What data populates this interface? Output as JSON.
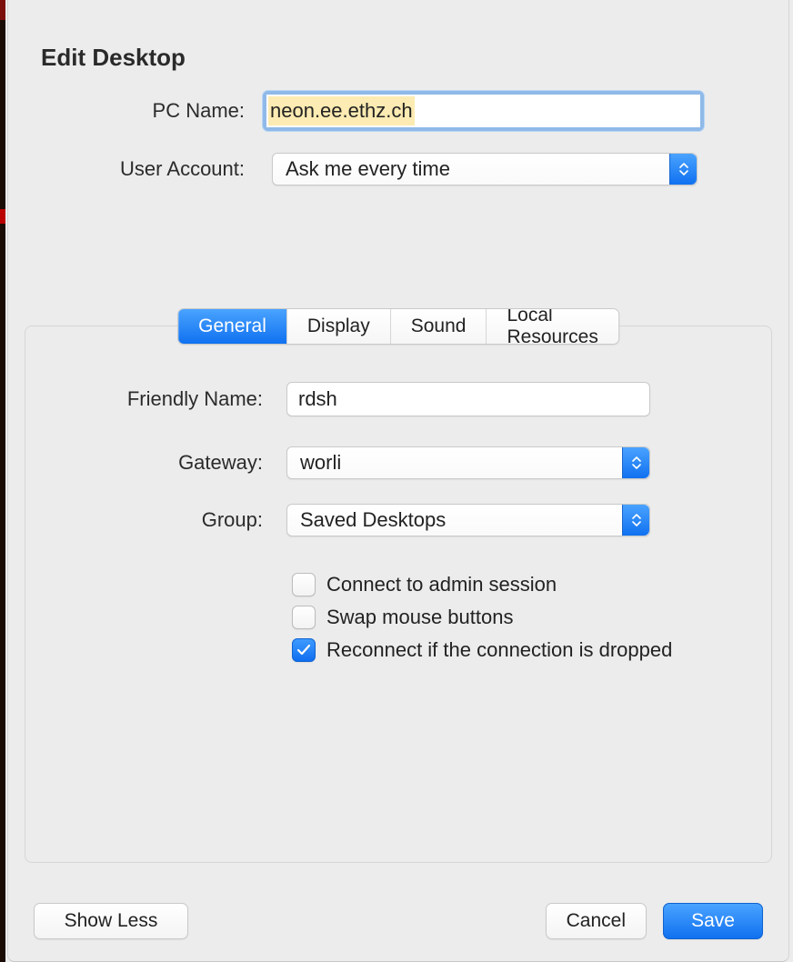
{
  "title": "Edit Desktop",
  "labels": {
    "pc_name": "PC Name:",
    "user_account": "User Account:",
    "friendly_name": "Friendly Name:",
    "gateway": "Gateway:",
    "group": "Group:"
  },
  "fields": {
    "pc_name_value": "neon.ee.ethz.ch",
    "user_account_value": "Ask me every time",
    "friendly_name_value": "rdsh",
    "gateway_value": "worli",
    "group_value": "Saved Desktops"
  },
  "tabs": {
    "general": "General",
    "display": "Display",
    "sound": "Sound",
    "local_resources": "Local Resources",
    "active": "general"
  },
  "checkboxes": {
    "admin_session": {
      "label": "Connect to admin session",
      "checked": false
    },
    "swap_mouse": {
      "label": "Swap mouse buttons",
      "checked": false
    },
    "reconnect": {
      "label": "Reconnect if the connection is dropped",
      "checked": true
    }
  },
  "buttons": {
    "show_less": "Show Less",
    "cancel": "Cancel",
    "save": "Save"
  }
}
